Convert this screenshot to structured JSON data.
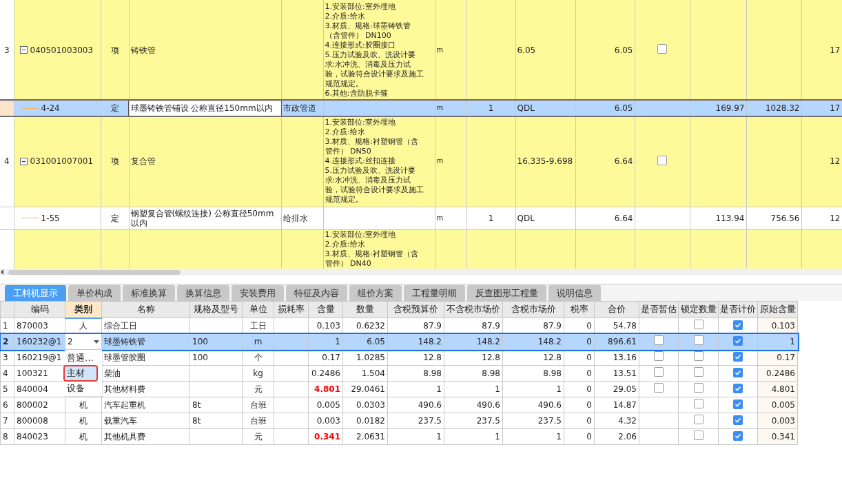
{
  "bill_rows": [
    {
      "kind": "item",
      "selected": false,
      "number": "3",
      "code": "040501003003",
      "expanded": true,
      "type": "项",
      "name": "铸铁管",
      "features": [
        "1.安装部位:室外埋地",
        "2.介质:给水",
        "3.材质、规格:球墨铸铁管",
        "（含管件） DN100",
        "4.连接形式:胶圈接口",
        "5.压力试验及吹、洗设计要",
        "求:水冲洗、消毒及压力试",
        "验，试验符合设计要求及施工",
        "规范规定。",
        "6.其他:含防脱卡箍"
      ],
      "unit": "m",
      "column_9": "6.05",
      "column_10": "6.05",
      "checked": false,
      "column_14": "17"
    },
    {
      "kind": "sub",
      "selected": true,
      "code": "4-24",
      "type": "定",
      "name": "球墨铸铁管铺设  公称直径150mm以内",
      "column_5": "市政管道",
      "unit": "m",
      "column_8": "1",
      "column_9": "QDL",
      "column_10": "6.05",
      "column_12": "169.97",
      "column_13": "1028.32",
      "column_14": "17"
    },
    {
      "kind": "item",
      "selected": false,
      "number": "4",
      "code": "031001007001",
      "expanded": true,
      "type": "项",
      "name": "复合管",
      "features": [
        "1.安装部位:室外埋地",
        "2.介质:给水",
        "3.材质、规格:衬塑钢管（含",
        "管件） DN50",
        "4.连接形式:丝扣连接",
        "5.压力试验及吹、洗设计要",
        "求:水冲洗、消毒及压力试",
        "验，试验符合设计要求及施工",
        "规范规定。"
      ],
      "unit": "m",
      "column_9": "16.335-9.698",
      "column_10": "6.64",
      "checked": false,
      "column_14": "12"
    },
    {
      "kind": "sub",
      "selected": false,
      "code": "1-55",
      "type": "定",
      "name": "钢塑复合管(螺纹连接) 公称直径50mm以内",
      "column_5": "给排水",
      "unit": "m",
      "column_8": "1",
      "column_9": "QDL",
      "column_10": "6.64",
      "column_12": "113.94",
      "column_13": "756.56",
      "column_14": "12"
    },
    {
      "kind": "item",
      "selected": false,
      "features": [
        "1.安装部位:室外埋地",
        "2.介质:给水",
        "3.材质、规格:衬塑钢管（含",
        "管件） DN40"
      ]
    }
  ],
  "tabs": [
    {
      "label": "工料机显示",
      "selected": true
    },
    {
      "label": "单价构成",
      "selected": false
    },
    {
      "label": "标准换算",
      "selected": false
    },
    {
      "label": "换算信息",
      "selected": false
    },
    {
      "label": "安装费用",
      "selected": false
    },
    {
      "label": "特征及内容",
      "selected": false
    },
    {
      "label": "组价方案",
      "selected": false
    },
    {
      "label": "工程量明细",
      "selected": false
    },
    {
      "label": "反查图形工程量",
      "selected": false
    },
    {
      "label": "说明信息",
      "selected": false
    }
  ],
  "columns": [
    {
      "label": "编码",
      "active": false
    },
    {
      "label": "类别",
      "active": true
    },
    {
      "label": "名称",
      "active": false
    },
    {
      "label": "规格及型号",
      "active": false
    },
    {
      "label": "单位",
      "active": false
    },
    {
      "label": "损耗率",
      "active": false
    },
    {
      "label": "含量",
      "active": false
    },
    {
      "label": "数量",
      "active": false
    },
    {
      "label": "含税预算价",
      "active": false
    },
    {
      "label": "不含税市场价",
      "active": false
    },
    {
      "label": "含税市场价",
      "active": false
    },
    {
      "label": "税率",
      "active": false
    },
    {
      "label": "合价",
      "active": false
    },
    {
      "label": "是否暂估",
      "active": false
    },
    {
      "label": "锁定数量",
      "active": false
    },
    {
      "label": "是否计价",
      "active": false
    },
    {
      "label": "原始含量",
      "active": false
    }
  ],
  "rows": [
    {
      "number": "1",
      "selected": false,
      "code": "870003",
      "category": "人",
      "name": "综合工日",
      "unit": "工日",
      "content": "0.103",
      "content_changed": false,
      "quantity": "0.6232",
      "budget_price": "87.9",
      "market_price_ex_tax": "87.9",
      "market_price": "87.9",
      "tax_rate": "0",
      "total": "54.78",
      "locked": false,
      "priced": true,
      "original_content": "0.103"
    },
    {
      "number": "2",
      "selected": true,
      "code": "160232@1",
      "category": "2",
      "name": "球墨铸铁管",
      "spec": "100",
      "unit": "m",
      "content": "1",
      "content_changed": false,
      "quantity": "6.05",
      "budget_price": "148.2",
      "market_price_ex_tax": "148.2",
      "market_price": "148.2",
      "tax_rate": "0",
      "total": "896.61",
      "estimated": false,
      "locked": false,
      "priced": true,
      "original_content": "1"
    },
    {
      "number": "3",
      "selected": false,
      "code": "160219@1",
      "name": "球墨管胶圈",
      "spec": "100",
      "unit": "个",
      "content": "0.17",
      "content_changed": false,
      "quantity": "1.0285",
      "budget_price": "12.8",
      "market_price_ex_tax": "12.8",
      "market_price": "12.8",
      "tax_rate": "0",
      "total": "13.16",
      "estimated": false,
      "locked": false,
      "priced": true,
      "original_content": "0.17"
    },
    {
      "number": "4",
      "selected": false,
      "code": "100321",
      "name": "柴油",
      "unit": "kg",
      "content": "0.2486",
      "content_changed": false,
      "quantity": "1.504",
      "budget_price": "8.98",
      "market_price_ex_tax": "8.98",
      "market_price": "8.98",
      "tax_rate": "0",
      "total": "13.51",
      "estimated": false,
      "locked": false,
      "priced": true,
      "original_content": "0.2486"
    },
    {
      "number": "5",
      "selected": false,
      "code": "840004",
      "name": "其他材料费",
      "unit": "元",
      "content": "4.801",
      "content_changed": true,
      "quantity": "29.0461",
      "budget_price": "1",
      "market_price_ex_tax": "1",
      "market_price": "1",
      "tax_rate": "0",
      "total": "29.05",
      "estimated": false,
      "locked": false,
      "priced": true,
      "original_content": "4.801"
    },
    {
      "number": "6",
      "selected": false,
      "code": "800002",
      "category": "机",
      "name": "汽车起重机",
      "spec": "8t",
      "unit": "台班",
      "content": "0.005",
      "content_changed": false,
      "quantity": "0.0303",
      "budget_price": "490.6",
      "market_price_ex_tax": "490.6",
      "market_price": "490.6",
      "tax_rate": "0",
      "total": "14.87",
      "locked": false,
      "priced": true,
      "original_content": "0.005"
    },
    {
      "number": "7",
      "selected": false,
      "code": "800008",
      "category": "机",
      "name": "载重汽车",
      "spec": "8t",
      "unit": "台班",
      "content": "0.003",
      "content_changed": false,
      "quantity": "0.0182",
      "budget_price": "237.5",
      "market_price_ex_tax": "237.5",
      "market_price": "237.5",
      "tax_rate": "0",
      "total": "4.32",
      "locked": false,
      "priced": true,
      "original_content": "0.003"
    },
    {
      "number": "8",
      "selected": false,
      "code": "840023",
      "category": "机",
      "name": "其他机具费",
      "unit": "元",
      "content": "0.341",
      "content_changed": true,
      "quantity": "2.0631",
      "budget_price": "1",
      "market_price_ex_tax": "1",
      "market_price": "1",
      "tax_rate": "0",
      "total": "2.06",
      "locked": false,
      "priced": true,
      "original_content": "0.341"
    }
  ],
  "category_dropdown": {
    "options": [
      {
        "label": "普通…",
        "selected": false
      },
      {
        "label": "主材",
        "selected": true
      },
      {
        "label": "设备",
        "selected": false
      }
    ]
  }
}
